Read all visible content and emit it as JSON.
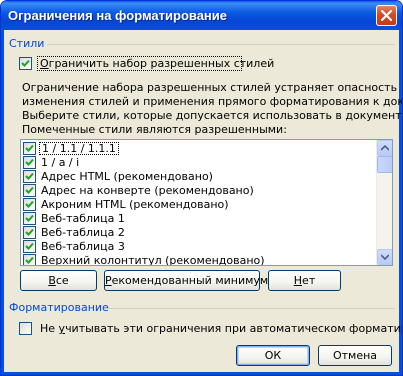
{
  "window": {
    "title": "Ограничения на форматирование"
  },
  "styles_group": {
    "label": "Стили",
    "limit_checkbox": {
      "label_accel": "О",
      "label_rest": "граничить набор разрешенных стилей",
      "checked": true
    },
    "description": [
      "Ограничение набора разрешенных стилей устраняет опасность",
      "изменения стилей и применения прямого форматирования к документу.",
      "Выберите стили, которые допускается использовать в документе."
    ],
    "list_label": "Помеченные стили являются разрешенными:",
    "styles": [
      {
        "name": "1 / 1.1 / 1.1.1",
        "checked": true,
        "selected": true
      },
      {
        "name": "1 / a / i",
        "checked": true
      },
      {
        "name": "Адрес HTML (рекомендовано)",
        "checked": true
      },
      {
        "name": "Адрес на конверте (рекомендовано)",
        "checked": true
      },
      {
        "name": "Акроним HTML (рекомендовано)",
        "checked": true
      },
      {
        "name": "Веб-таблица 1",
        "checked": true
      },
      {
        "name": "Веб-таблица 2",
        "checked": true
      },
      {
        "name": "Веб-таблица 3",
        "checked": true
      },
      {
        "name": "Верхний колонтитул (рекомендовано)",
        "checked": true
      }
    ],
    "scroll_position": 0.0,
    "buttons": {
      "all": {
        "accel": "В",
        "rest": "се"
      },
      "recommended": {
        "accel": "Р",
        "rest": "екомендованный минимум"
      },
      "none": {
        "accel": "Н",
        "rest": "ет"
      }
    }
  },
  "format_group": {
    "label": "Форматирование",
    "autoformat_checkbox": {
      "pre": "Не ",
      "accel": "у",
      "rest": "читывать эти ограничения при автоматическом форматировании",
      "checked": false
    }
  },
  "dialog_buttons": {
    "ok": "ОК",
    "cancel": "Отмена"
  },
  "colors": {
    "title_bar": "#0a5ae0",
    "group_label": "#0046d5",
    "check": "#21a121",
    "dialog_bg": "#ece9d8"
  }
}
